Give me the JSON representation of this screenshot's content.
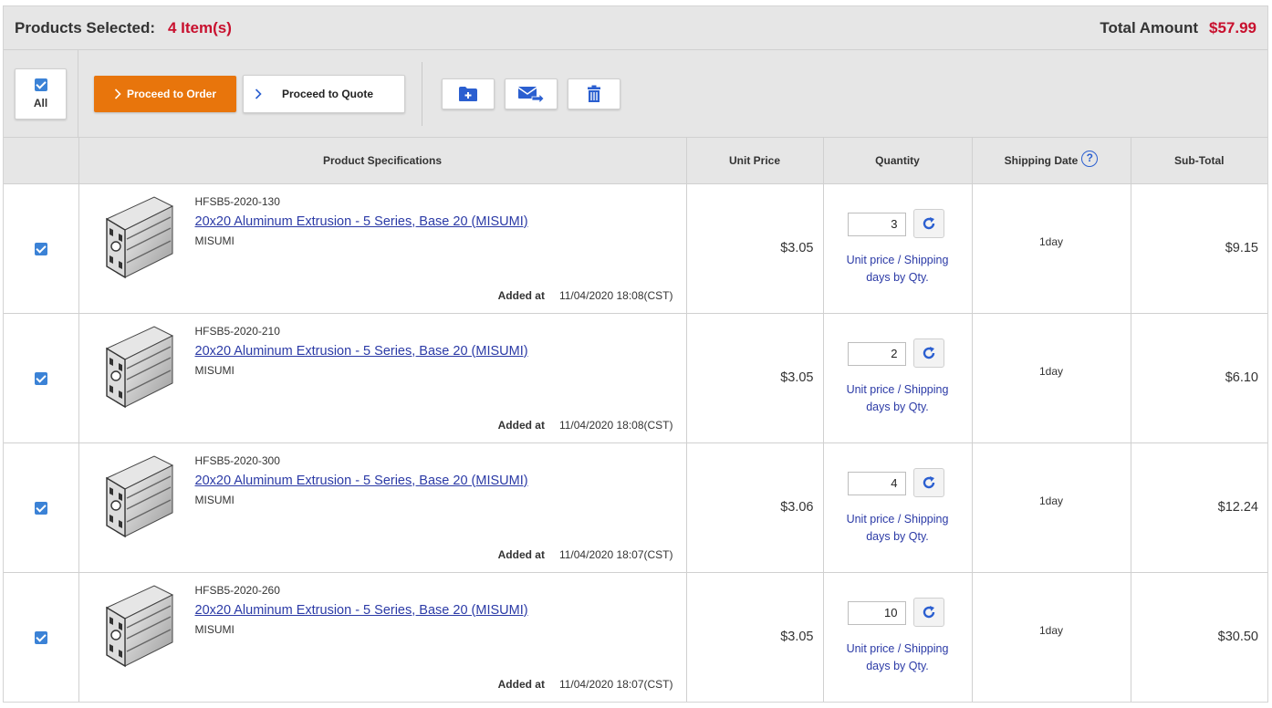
{
  "header": {
    "products_selected_label": "Products Selected:",
    "items_count": "4 Item(s)",
    "total_label": "Total Amount",
    "total_value": "$57.99"
  },
  "toolbar": {
    "all_label": "All",
    "proceed_order_label": "Proceed to Order",
    "proceed_quote_label": "Proceed to Quote"
  },
  "columns": {
    "spec": "Product Specifications",
    "unit_price": "Unit Price",
    "quantity": "Quantity",
    "shipping_date": "Shipping Date",
    "subtotal": "Sub-Total"
  },
  "rows": [
    {
      "code": "HFSB5-2020-130",
      "title": "20x20 Aluminum Extrusion - 5 Series, Base 20 (MISUMI)",
      "brand": "MISUMI",
      "added_label": "Added at",
      "added_time": "11/04/2020 18:08(CST)",
      "unit_price": "$3.05",
      "quantity": "3",
      "qty_link_1": "Unit price / Shipping",
      "qty_link_2": "days by Qty.",
      "shipping": "1day",
      "subtotal": "$9.15"
    },
    {
      "code": "HFSB5-2020-210",
      "title": "20x20 Aluminum Extrusion - 5 Series, Base 20 (MISUMI)",
      "brand": "MISUMI",
      "added_label": "Added at",
      "added_time": "11/04/2020 18:08(CST)",
      "unit_price": "$3.05",
      "quantity": "2",
      "qty_link_1": "Unit price / Shipping",
      "qty_link_2": "days by Qty.",
      "shipping": "1day",
      "subtotal": "$6.10"
    },
    {
      "code": "HFSB5-2020-300",
      "title": "20x20 Aluminum Extrusion - 5 Series, Base 20 (MISUMI)",
      "brand": "MISUMI",
      "added_label": "Added at",
      "added_time": "11/04/2020 18:07(CST)",
      "unit_price": "$3.06",
      "quantity": "4",
      "qty_link_1": "Unit price / Shipping",
      "qty_link_2": "days by Qty.",
      "shipping": "1day",
      "subtotal": "$12.24"
    },
    {
      "code": "HFSB5-2020-260",
      "title": "20x20 Aluminum Extrusion - 5 Series, Base 20 (MISUMI)",
      "brand": "MISUMI",
      "added_label": "Added at",
      "added_time": "11/04/2020 18:07(CST)",
      "unit_price": "$3.05",
      "quantity": "10",
      "qty_link_1": "Unit price / Shipping",
      "qty_link_2": "days by Qty.",
      "shipping": "1day",
      "subtotal": "$30.50"
    }
  ],
  "colors": {
    "accent_orange": "#e8750c",
    "price_red": "#c8102e",
    "link_blue": "#2b3aa6",
    "checkbox_blue": "#3b82d6"
  },
  "icons": {
    "add_folder": "folder-plus-icon",
    "send_mail": "mail-forward-icon",
    "delete": "trash-icon",
    "refresh": "refresh-icon",
    "help": "question-circle-icon"
  }
}
